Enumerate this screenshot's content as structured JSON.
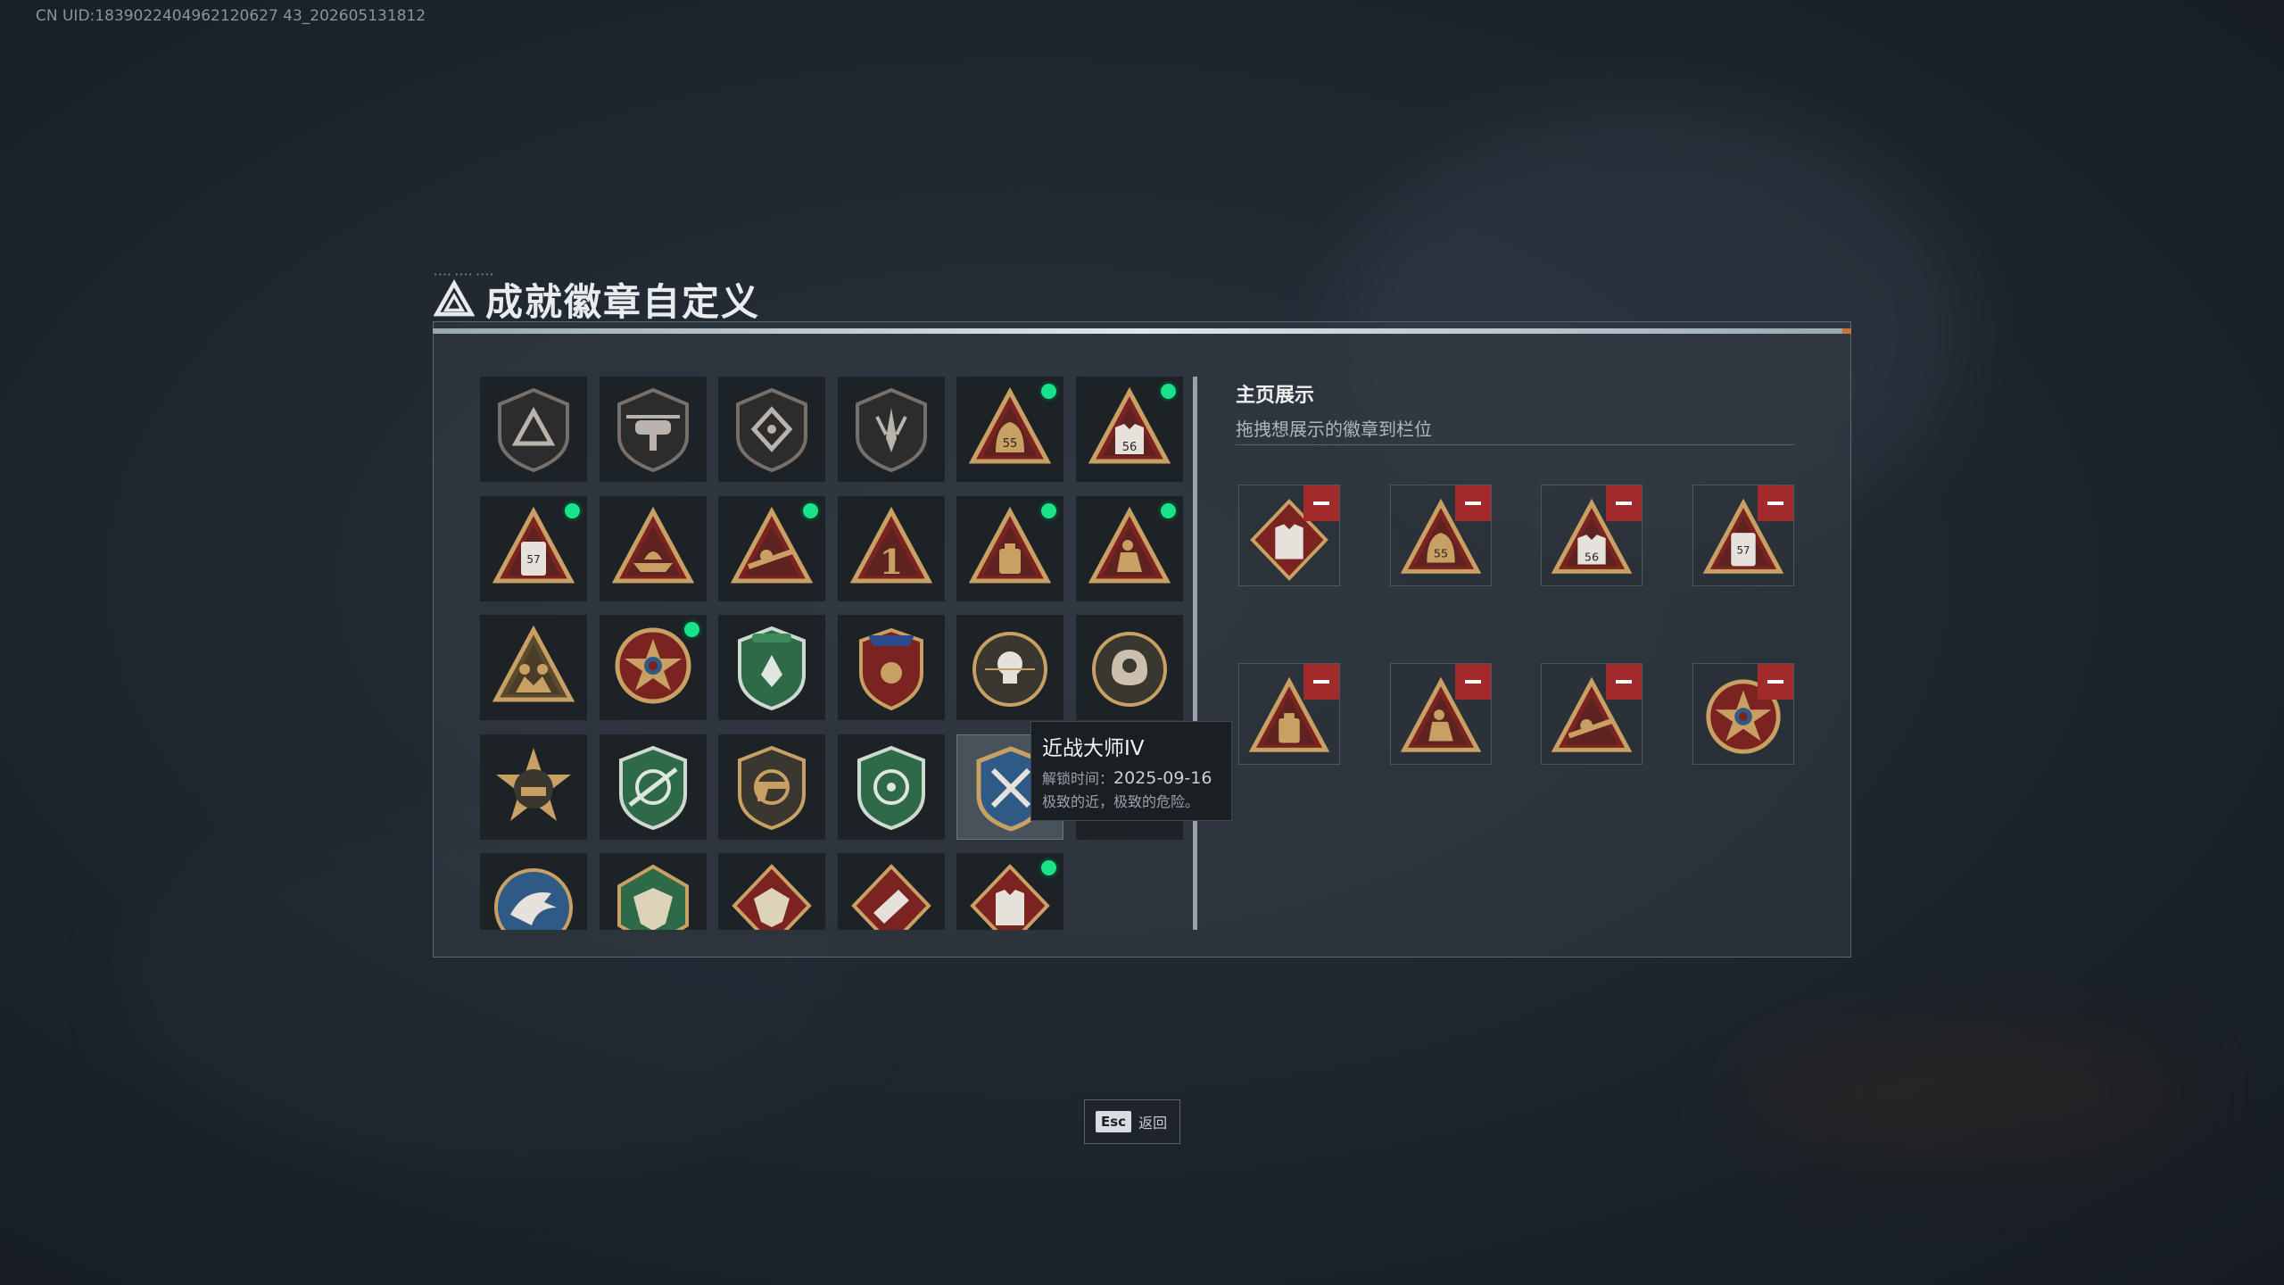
{
  "uid_text": "CN UID:1839022404962120627 43_202605131812",
  "title": "成就徽章自定义",
  "title_deco": "•••• •••• ••••",
  "showcase": {
    "title": "主页展示",
    "subtitle": "拖拽想展示的徽章到栏位"
  },
  "tooltip": {
    "title": "近战大师IV",
    "unlock_label": "解锁时间：",
    "unlock_date": "2025-09-16",
    "description": "极致的近，极致的危险。"
  },
  "footer": {
    "esc_key": "Esc",
    "esc_label": "返回"
  },
  "colors": {
    "new_indicator": "#19e38a",
    "remove_button": "#a32a2a",
    "gold": "#c9a063",
    "dark_red": "#7a2320",
    "green_badge": "#2f6a48",
    "blue_badge": "#2f5a86"
  },
  "badges": [
    {
      "icon": "shield-triangle-badge",
      "has_new": false
    },
    {
      "icon": "helicopter-shield-badge",
      "has_new": false
    },
    {
      "icon": "diamond-shield-badge",
      "has_new": false
    },
    {
      "icon": "blade-shield-badge",
      "has_new": false
    },
    {
      "icon": "bag-55-badge",
      "has_new": true
    },
    {
      "icon": "vest-56-badge",
      "has_new": true
    },
    {
      "icon": "canister-57-badge",
      "has_new": true
    },
    {
      "icon": "boat-triangle-badge",
      "has_new": false
    },
    {
      "icon": "sniper-triangle-badge",
      "has_new": true
    },
    {
      "icon": "number-one-triangle-badge",
      "has_new": false
    },
    {
      "icon": "backpack-triangle-badge",
      "has_new": true
    },
    {
      "icon": "crouch-soldier-triangle-badge",
      "has_new": true
    },
    {
      "icon": "squad-triangle-badge",
      "has_new": false
    },
    {
      "icon": "star-medal-badge",
      "has_new": true
    },
    {
      "icon": "green-crest-badge",
      "has_new": false
    },
    {
      "icon": "red-crest-badge",
      "has_new": false
    },
    {
      "icon": "skull-medallion-badge",
      "has_new": false
    },
    {
      "icon": "brain-medallion-badge",
      "has_new": false
    },
    {
      "icon": "tank-star-badge",
      "has_new": false
    },
    {
      "icon": "green-rifle-shield-badge",
      "has_new": false
    },
    {
      "icon": "pistol-shield-badge",
      "has_new": false
    },
    {
      "icon": "green-target-shield-badge",
      "has_new": false
    },
    {
      "icon": "melee-master-badge",
      "has_new": false
    },
    {
      "icon": "hidden-badge",
      "has_new": false
    },
    {
      "icon": "eagle-badge",
      "has_new": false
    },
    {
      "icon": "green-beast-badge",
      "has_new": false
    },
    {
      "icon": "red-beast-badge",
      "has_new": false
    },
    {
      "icon": "red-bandage-badge",
      "has_new": false
    },
    {
      "icon": "red-vest-badge",
      "has_new": true
    }
  ],
  "showcase_slots": [
    {
      "icon": "red-vest-badge"
    },
    {
      "icon": "bag-55-badge"
    },
    {
      "icon": "vest-56-badge"
    },
    {
      "icon": "canister-57-badge"
    },
    {
      "icon": "backpack-triangle-badge"
    },
    {
      "icon": "crouch-soldier-triangle-badge"
    },
    {
      "icon": "sniper-triangle-badge"
    },
    {
      "icon": "star-medal-badge"
    }
  ]
}
